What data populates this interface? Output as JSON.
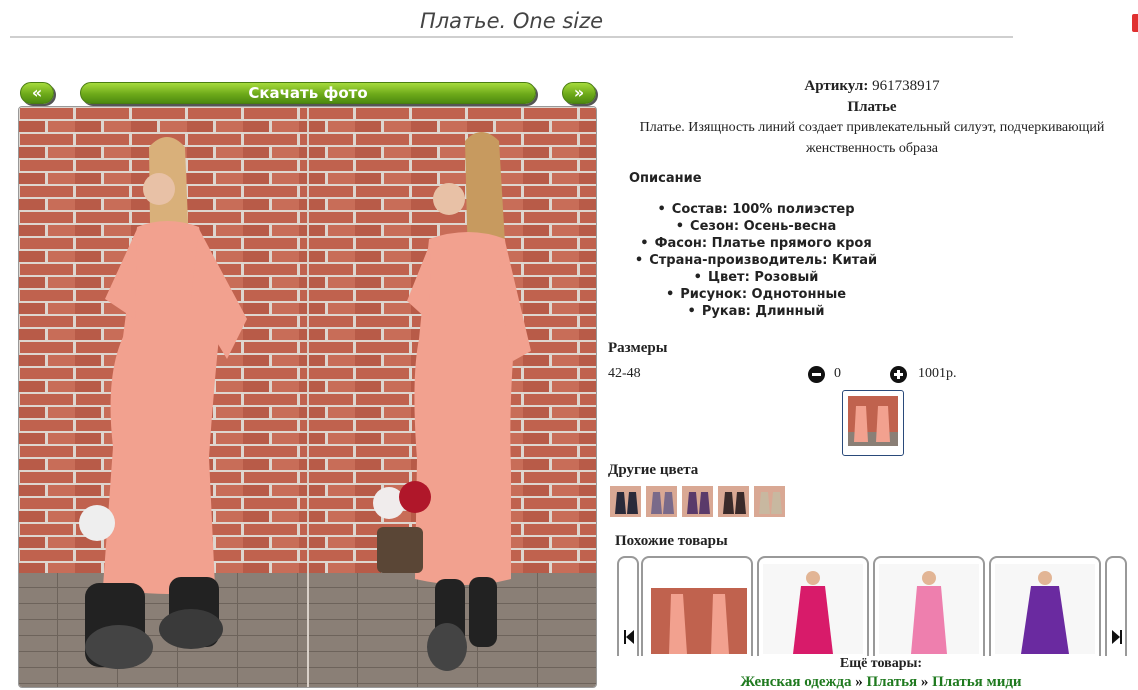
{
  "page": {
    "title": "Платье. One size"
  },
  "photo_nav": {
    "prev_label": "«",
    "next_label": "»",
    "download_label": "Скачать фото"
  },
  "product": {
    "sku_label": "Артикул:",
    "sku_value": "961738917",
    "name": "Платье",
    "short_description": "Платье. Изящность линий создает привлекательный силуэт, подчеркивающий женственность образа"
  },
  "description": {
    "heading": "Описание",
    "items": [
      "Состав: 100% полиэстер",
      "Сезон: Осень-весна",
      "Фасон: Платье прямого кроя",
      "Страна-производитель: Китай",
      "Цвет: Розовый",
      "Рисунок: Однотонные",
      "Рукав: Длинный"
    ]
  },
  "sizes": {
    "heading": "Размеры",
    "rows": [
      {
        "size": "42-48",
        "quantity": "0",
        "price": "1001р."
      }
    ]
  },
  "other_colors": {
    "heading": "Другие цвета",
    "thumbs": [
      {
        "color": "#2a2a3a",
        "icon": "dark-dress-thumb"
      },
      {
        "color": "#7a6a8a",
        "icon": "grey-dress-thumb"
      },
      {
        "color": "#5a3a6a",
        "icon": "purple-dress-thumb"
      },
      {
        "color": "#3a2a2a",
        "icon": "black-dress-thumb"
      },
      {
        "color": "#c8b8a0",
        "icon": "beige-dress-thumb"
      }
    ]
  },
  "similar": {
    "heading": "Похожие товары",
    "items": [
      {
        "color": "#f2a18f",
        "icon": "pink-dress-thumb"
      },
      {
        "color": "#d81b6a",
        "icon": "magenta-dress-thumb"
      },
      {
        "color": "#ee7fae",
        "icon": "pink-dress-thumb"
      },
      {
        "color": "#6a2aa0",
        "icon": "violet-dress-thumb"
      }
    ]
  },
  "more": {
    "heading": "Ещё товары:",
    "breadcrumb": [
      "Женская одежда",
      "Платья",
      "Платья миди"
    ],
    "separator": "»"
  },
  "colors": {
    "accent_green": "#6eaa1a",
    "link_green": "#1f7a1f",
    "brick": "#b9654f",
    "dress_pink": "#f2a18f"
  }
}
